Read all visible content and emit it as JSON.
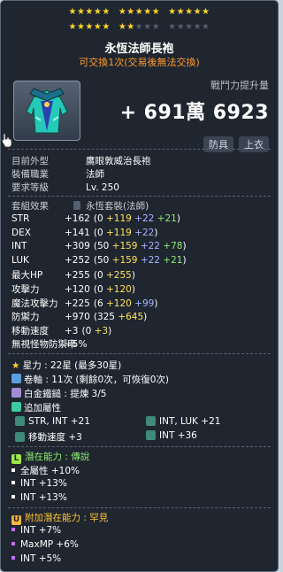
{
  "stars": {
    "filled": 22,
    "total": 30
  },
  "item": {
    "name": "永恆法師長袍",
    "trade": "可交換1次(交易後無法交換)"
  },
  "cp": {
    "label": "戰鬥力提升量",
    "value": "+ 691萬 6923"
  },
  "tags": [
    "防具",
    "上衣"
  ],
  "info": [
    {
      "k": "目前外型",
      "v": "鷹眼敦威治長袍"
    },
    {
      "k": "裝備職業",
      "v": "法師"
    },
    {
      "k": "要求等級",
      "v": "Lv. 250"
    }
  ],
  "set": {
    "k": "套組效果",
    "v": "永恆套裝(法師)"
  },
  "stats": [
    {
      "k": "STR",
      "v": "+162",
      "p": [
        {
          "t": "(0 ",
          "c": "w"
        },
        {
          "t": "+119",
          "c": "y"
        },
        {
          "t": " +22",
          "c": "b"
        },
        {
          "t": " +21",
          "c": "g"
        },
        {
          "t": ")",
          "c": "w"
        }
      ]
    },
    {
      "k": "DEX",
      "v": "+141",
      "p": [
        {
          "t": "(0 ",
          "c": "w"
        },
        {
          "t": "+119",
          "c": "y"
        },
        {
          "t": " +22",
          "c": "b"
        },
        {
          "t": ")",
          "c": "w"
        }
      ]
    },
    {
      "k": "INT",
      "v": "+309",
      "p": [
        {
          "t": "(50 ",
          "c": "w"
        },
        {
          "t": "+159",
          "c": "y"
        },
        {
          "t": " +22",
          "c": "b"
        },
        {
          "t": " +78",
          "c": "g"
        },
        {
          "t": ")",
          "c": "w"
        }
      ]
    },
    {
      "k": "LUK",
      "v": "+252",
      "p": [
        {
          "t": "(50 ",
          "c": "w"
        },
        {
          "t": "+159",
          "c": "y"
        },
        {
          "t": " +22",
          "c": "b"
        },
        {
          "t": " +21",
          "c": "g"
        },
        {
          "t": ")",
          "c": "w"
        }
      ]
    },
    {
      "k": "最大HP",
      "v": "+255",
      "p": [
        {
          "t": "(0 ",
          "c": "w"
        },
        {
          "t": "+255",
          "c": "y"
        },
        {
          "t": ")",
          "c": "w"
        }
      ]
    },
    {
      "k": "攻擊力",
      "v": "+120",
      "p": [
        {
          "t": "(0 ",
          "c": "w"
        },
        {
          "t": "+120",
          "c": "y"
        },
        {
          "t": ")",
          "c": "w"
        }
      ]
    },
    {
      "k": "魔法攻擊力",
      "v": "+225",
      "p": [
        {
          "t": "(6 ",
          "c": "w"
        },
        {
          "t": "+120",
          "c": "y"
        },
        {
          "t": " +99",
          "c": "b"
        },
        {
          "t": ")",
          "c": "w"
        }
      ]
    },
    {
      "k": "防禦力",
      "v": "+970",
      "p": [
        {
          "t": "(325 ",
          "c": "w"
        },
        {
          "t": "+645",
          "c": "y"
        },
        {
          "t": ")",
          "c": "w"
        }
      ]
    },
    {
      "k": "移動速度",
      "v": "+3",
      "p": [
        {
          "t": "(0 ",
          "c": "w"
        },
        {
          "t": "+3",
          "c": "y"
        },
        {
          "t": ")",
          "c": "w"
        }
      ]
    },
    {
      "k": "無視怪物防禦率",
      "v": "+5%",
      "p": []
    }
  ],
  "enhance": {
    "star": "星力 : 22星 (最多30星)",
    "scroll": "卷軸 : 11次 (剩餘0次，可恢復0次)",
    "hammer": "白金鐵鎚 : 提煉 3/5",
    "add_title": "追加屬性",
    "add": [
      "STR, INT  +21",
      "INT, LUK  +21",
      "移動速度 +3",
      "INT  +36"
    ]
  },
  "potential": {
    "title": "潛在能力 : 傳說",
    "lines": [
      "全屬性 +10%",
      "INT +13%",
      "INT +13%"
    ]
  },
  "add_potential": {
    "title": "附加潛在能力 : 罕見",
    "lines": [
      "INT +7%",
      "MaxMP +6%",
      "INT +5%"
    ]
  }
}
